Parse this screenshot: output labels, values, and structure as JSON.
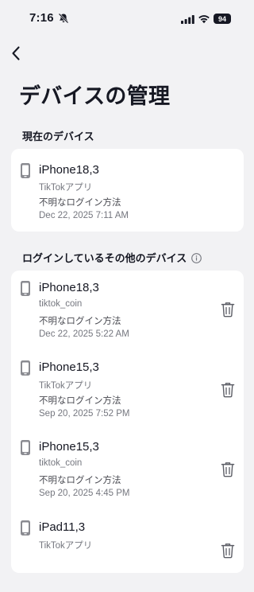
{
  "status_bar": {
    "time": "7:16",
    "battery": "94"
  },
  "page_title": "デバイスの管理",
  "current_section": {
    "label": "現在のデバイス",
    "device": {
      "name": "iPhone18,3",
      "app": "TikTokアプリ",
      "method": "不明なログイン方法",
      "date": "Dec 22, 2025 7:11 AM"
    }
  },
  "other_section": {
    "label": "ログインしているその他のデバイス",
    "devices": [
      {
        "name": "iPhone18,3",
        "app": "tiktok_coin",
        "method": "不明なログイン方法",
        "date": "Dec 22, 2025 5:22 AM"
      },
      {
        "name": "iPhone15,3",
        "app": "TikTokアプリ",
        "method": "不明なログイン方法",
        "date": "Sep 20, 2025 7:52 PM"
      },
      {
        "name": "iPhone15,3",
        "app": "tiktok_coin",
        "method": "不明なログイン方法",
        "date": "Sep 20, 2025 4:45 PM"
      },
      {
        "name": "iPad11,3",
        "app": "TikTokアプリ",
        "method": "",
        "date": ""
      }
    ]
  }
}
